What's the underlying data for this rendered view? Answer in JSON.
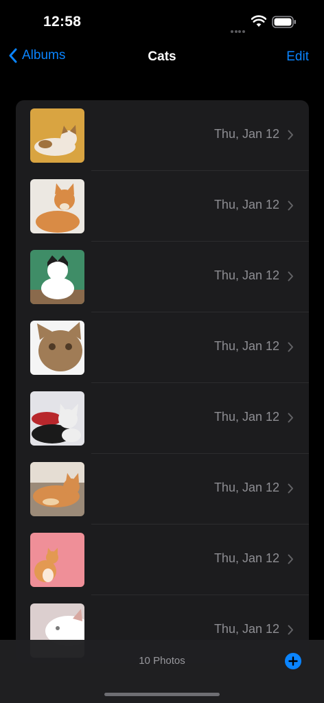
{
  "status": {
    "time": "12:58"
  },
  "nav": {
    "back_label": "Albums",
    "title": "Cats",
    "edit_label": "Edit"
  },
  "photos": [
    {
      "date": "Thu, Jan 12",
      "bg": "#d9a441",
      "fur": "#f0e7dc",
      "accent": "#a0723e"
    },
    {
      "date": "Thu, Jan 12",
      "bg": "#ece8e2",
      "fur": "#d98b45",
      "accent": "#f2e4cf"
    },
    {
      "date": "Thu, Jan 12",
      "bg": "#3f8d67",
      "fur": "#ffffff",
      "accent": "#1e1e1e"
    },
    {
      "date": "Thu, Jan 12",
      "bg": "#f5f5f5",
      "fur": "#a07c56",
      "accent": "#4f3a26"
    },
    {
      "date": "Thu, Jan 12",
      "bg": "#e3e3e8",
      "fur": "#eeeeee",
      "accent": "#b8272c"
    },
    {
      "date": "Thu, Jan 12",
      "bg": "#9b8a78",
      "fur": "#d78d4b",
      "accent": "#f0d2a6"
    },
    {
      "date": "Thu, Jan 12",
      "bg": "#ef8f98",
      "fur": "#e39952",
      "accent": "#fbe9da"
    },
    {
      "date": "Thu, Jan 12",
      "bg": "#dccfcf",
      "fur": "#ffffff",
      "accent": "#d7a7a0"
    }
  ],
  "toolbar": {
    "count_label": "10 Photos"
  },
  "colors": {
    "accent": "#0a84ff",
    "card": "#1c1c1e"
  }
}
